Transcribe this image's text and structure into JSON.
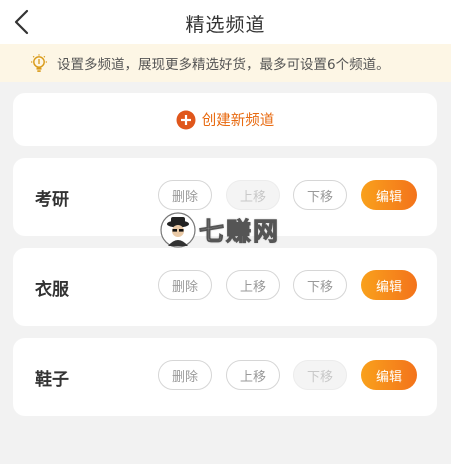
{
  "header": {
    "title": "精选频道",
    "back_icon": "chevron-left-icon"
  },
  "notice": {
    "icon": "lightbulb-icon",
    "text": "设置多频道，展现更多精选好货，最多可设置6个频道。"
  },
  "create": {
    "icon": "plus-circle-icon",
    "label": "创建新频道"
  },
  "channels": [
    {
      "name": "考研",
      "delete_label": "删除",
      "up_label": "上移",
      "down_label": "下移",
      "edit_label": "编辑",
      "delete_disabled": false,
      "up_disabled": true,
      "down_disabled": false
    },
    {
      "name": "衣服",
      "delete_label": "删除",
      "up_label": "上移",
      "down_label": "下移",
      "edit_label": "编辑",
      "delete_disabled": false,
      "up_disabled": false,
      "down_disabled": false
    },
    {
      "name": "鞋子",
      "delete_label": "删除",
      "up_label": "上移",
      "down_label": "下移",
      "edit_label": "编辑",
      "delete_disabled": false,
      "up_disabled": false,
      "down_disabled": true
    }
  ],
  "watermark": {
    "logo_icon": "watermark-avatar-logo",
    "text": "七赚网"
  },
  "colors": {
    "accent": "#f3731b",
    "accent_light": "#f9a11c",
    "notice_bg": "#fdf6e5",
    "page_bg": "#f2f2f2"
  }
}
